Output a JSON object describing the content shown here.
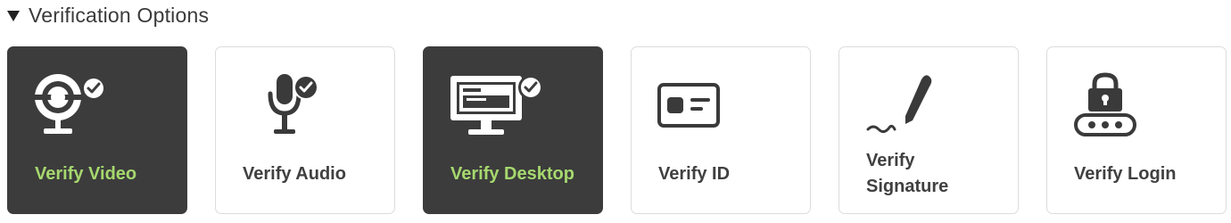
{
  "section": {
    "title": "Verification Options",
    "expanded": true
  },
  "colors": {
    "selected_bg": "#3c3c3c",
    "selected_label": "#a6d86e",
    "label": "#404040",
    "border": "#dcdcdc"
  },
  "options": [
    {
      "label": "Verify Video",
      "icon": "webcam-check-icon",
      "selected": true
    },
    {
      "label": "Verify Audio",
      "icon": "microphone-check-icon",
      "selected": false
    },
    {
      "label": "Verify Desktop",
      "icon": "monitor-check-icon",
      "selected": true
    },
    {
      "label": "Verify ID",
      "icon": "id-card-icon",
      "selected": false
    },
    {
      "label": "Verify Signature",
      "icon": "pen-signature-icon",
      "selected": false
    },
    {
      "label": "Verify Login",
      "icon": "lock-password-icon",
      "selected": false
    }
  ]
}
